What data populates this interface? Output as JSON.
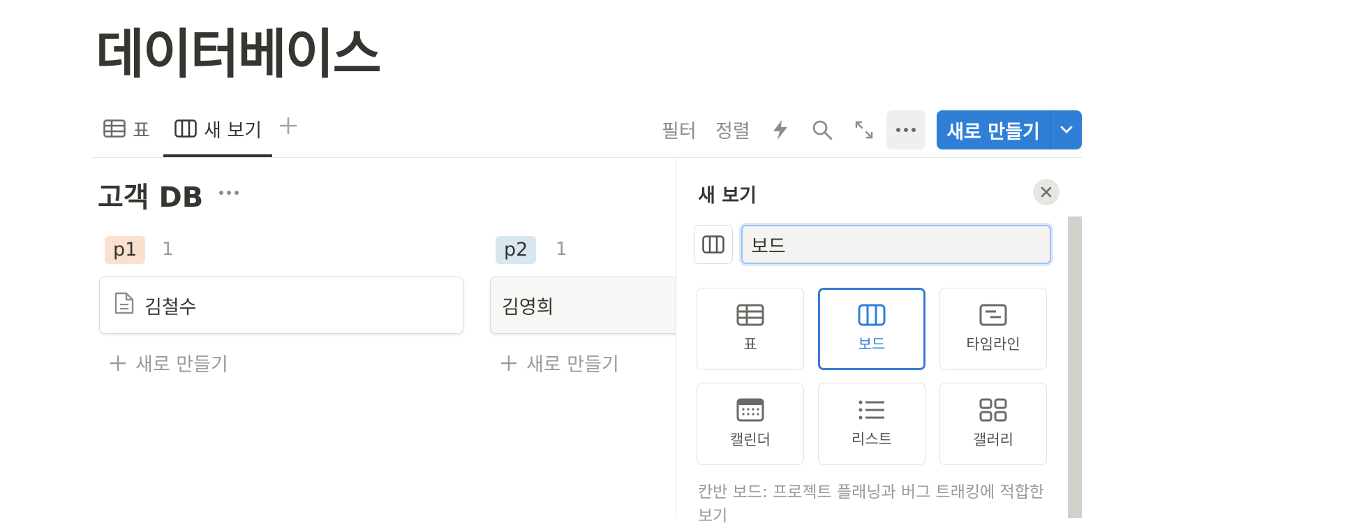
{
  "page": {
    "title": "데이터베이스"
  },
  "tabs": [
    {
      "label": "표",
      "icon": "table-icon"
    },
    {
      "label": "새 보기",
      "icon": "board-icon",
      "active": true
    }
  ],
  "toolbar": {
    "filter_label": "필터",
    "sort_label": "정렬",
    "new_label": "새로 만들기"
  },
  "database": {
    "title": "고객 DB",
    "groups": [
      {
        "tag": "p1",
        "count": "1",
        "tag_color": "#fae1cf",
        "cards": [
          "김철수"
        ],
        "new_label": "새로 만들기"
      },
      {
        "tag": "p2",
        "count": "1",
        "tag_color": "#d8e6f0",
        "cards": [
          "김영희"
        ],
        "new_label": "새로 만들기"
      }
    ]
  },
  "view_panel": {
    "title": "새 보기",
    "name_value": "보드",
    "layouts": [
      {
        "label": "표",
        "icon": "table-icon",
        "selected": false
      },
      {
        "label": "보드",
        "icon": "board-icon",
        "selected": true
      },
      {
        "label": "타임라인",
        "icon": "timeline-icon",
        "selected": false
      },
      {
        "label": "캘린더",
        "icon": "calendar-icon",
        "selected": false
      },
      {
        "label": "리스트",
        "icon": "list-icon",
        "selected": false
      },
      {
        "label": "갤러리",
        "icon": "gallery-icon",
        "selected": false
      }
    ],
    "description": "칸반 보드: 프로젝트 플래닝과 버그 트래킹에 적합한 보기"
  },
  "colors": {
    "accent": "#2f7fd6",
    "text": "#37352f",
    "muted": "#9b9a97"
  }
}
